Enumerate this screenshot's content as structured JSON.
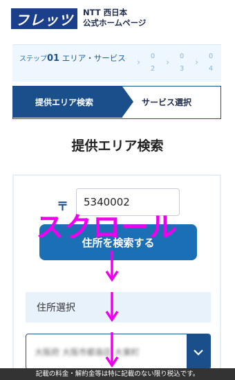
{
  "header": {
    "logo": "フレッツ",
    "company_line1": "NTT 西日本",
    "company_line2": "公式ホームページ"
  },
  "steps": {
    "step1_prefix": "ステップ",
    "step1_num": "01",
    "step1_label": "エリア・サービス",
    "others": [
      {
        "label": "0",
        "num": "2"
      },
      {
        "label": "0",
        "num": "3"
      },
      {
        "label": "0",
        "num": "4"
      }
    ]
  },
  "tabs": {
    "active": "提供エリア検索",
    "next": "サービス選択"
  },
  "page_title": "提供エリア検索",
  "form": {
    "postal_mark": "〒",
    "zip_value": "5340002",
    "search_button": "住所を検索する",
    "address_label": "住所選択",
    "address_value": "大阪府 大阪市都島区 大東町"
  },
  "annotation": {
    "text": "スクロール",
    "color": "#ee00ee"
  },
  "notice": "記載の料金・解約金等は特に記載のない限り税込です。"
}
